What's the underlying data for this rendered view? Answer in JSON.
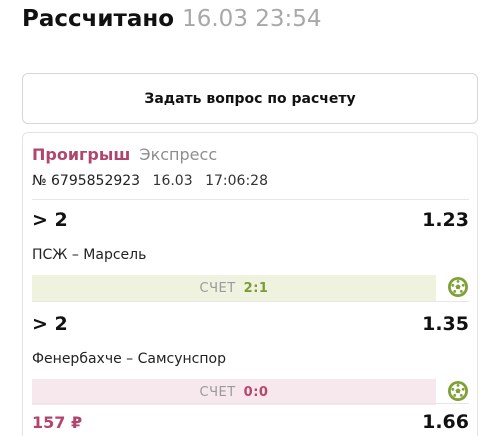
{
  "header": {
    "title": "Рассчитано",
    "datetime": "16.03 23:54"
  },
  "ask_button": {
    "label": "Задать вопрос по расчету"
  },
  "bet_card": {
    "status": "Проигрыш",
    "type": "Экспресс",
    "number": "№ 6795852923",
    "date": "16.03",
    "time": "17:06:28",
    "events": [
      {
        "pick": "> 2",
        "coef": "1.23",
        "match": "ПСЖ – Марсель",
        "score_label": "СЧЕТ",
        "score": "2:1",
        "result": "win",
        "icon": "soccer-ball-icon"
      },
      {
        "pick": "> 2",
        "coef": "1.35",
        "match": "Фенербахче – Самсунспор",
        "score_label": "СЧЕТ",
        "score": "0:0",
        "result": "lose",
        "icon": "soccer-ball-icon"
      }
    ],
    "stake": "157 ₽",
    "total_coef": "1.66"
  },
  "colors": {
    "lose": "#b0466e",
    "win_text": "#7f9a35",
    "win_bg": "#eef2df",
    "lose_bg": "#f6e8ec",
    "ball": "#7fa034"
  }
}
